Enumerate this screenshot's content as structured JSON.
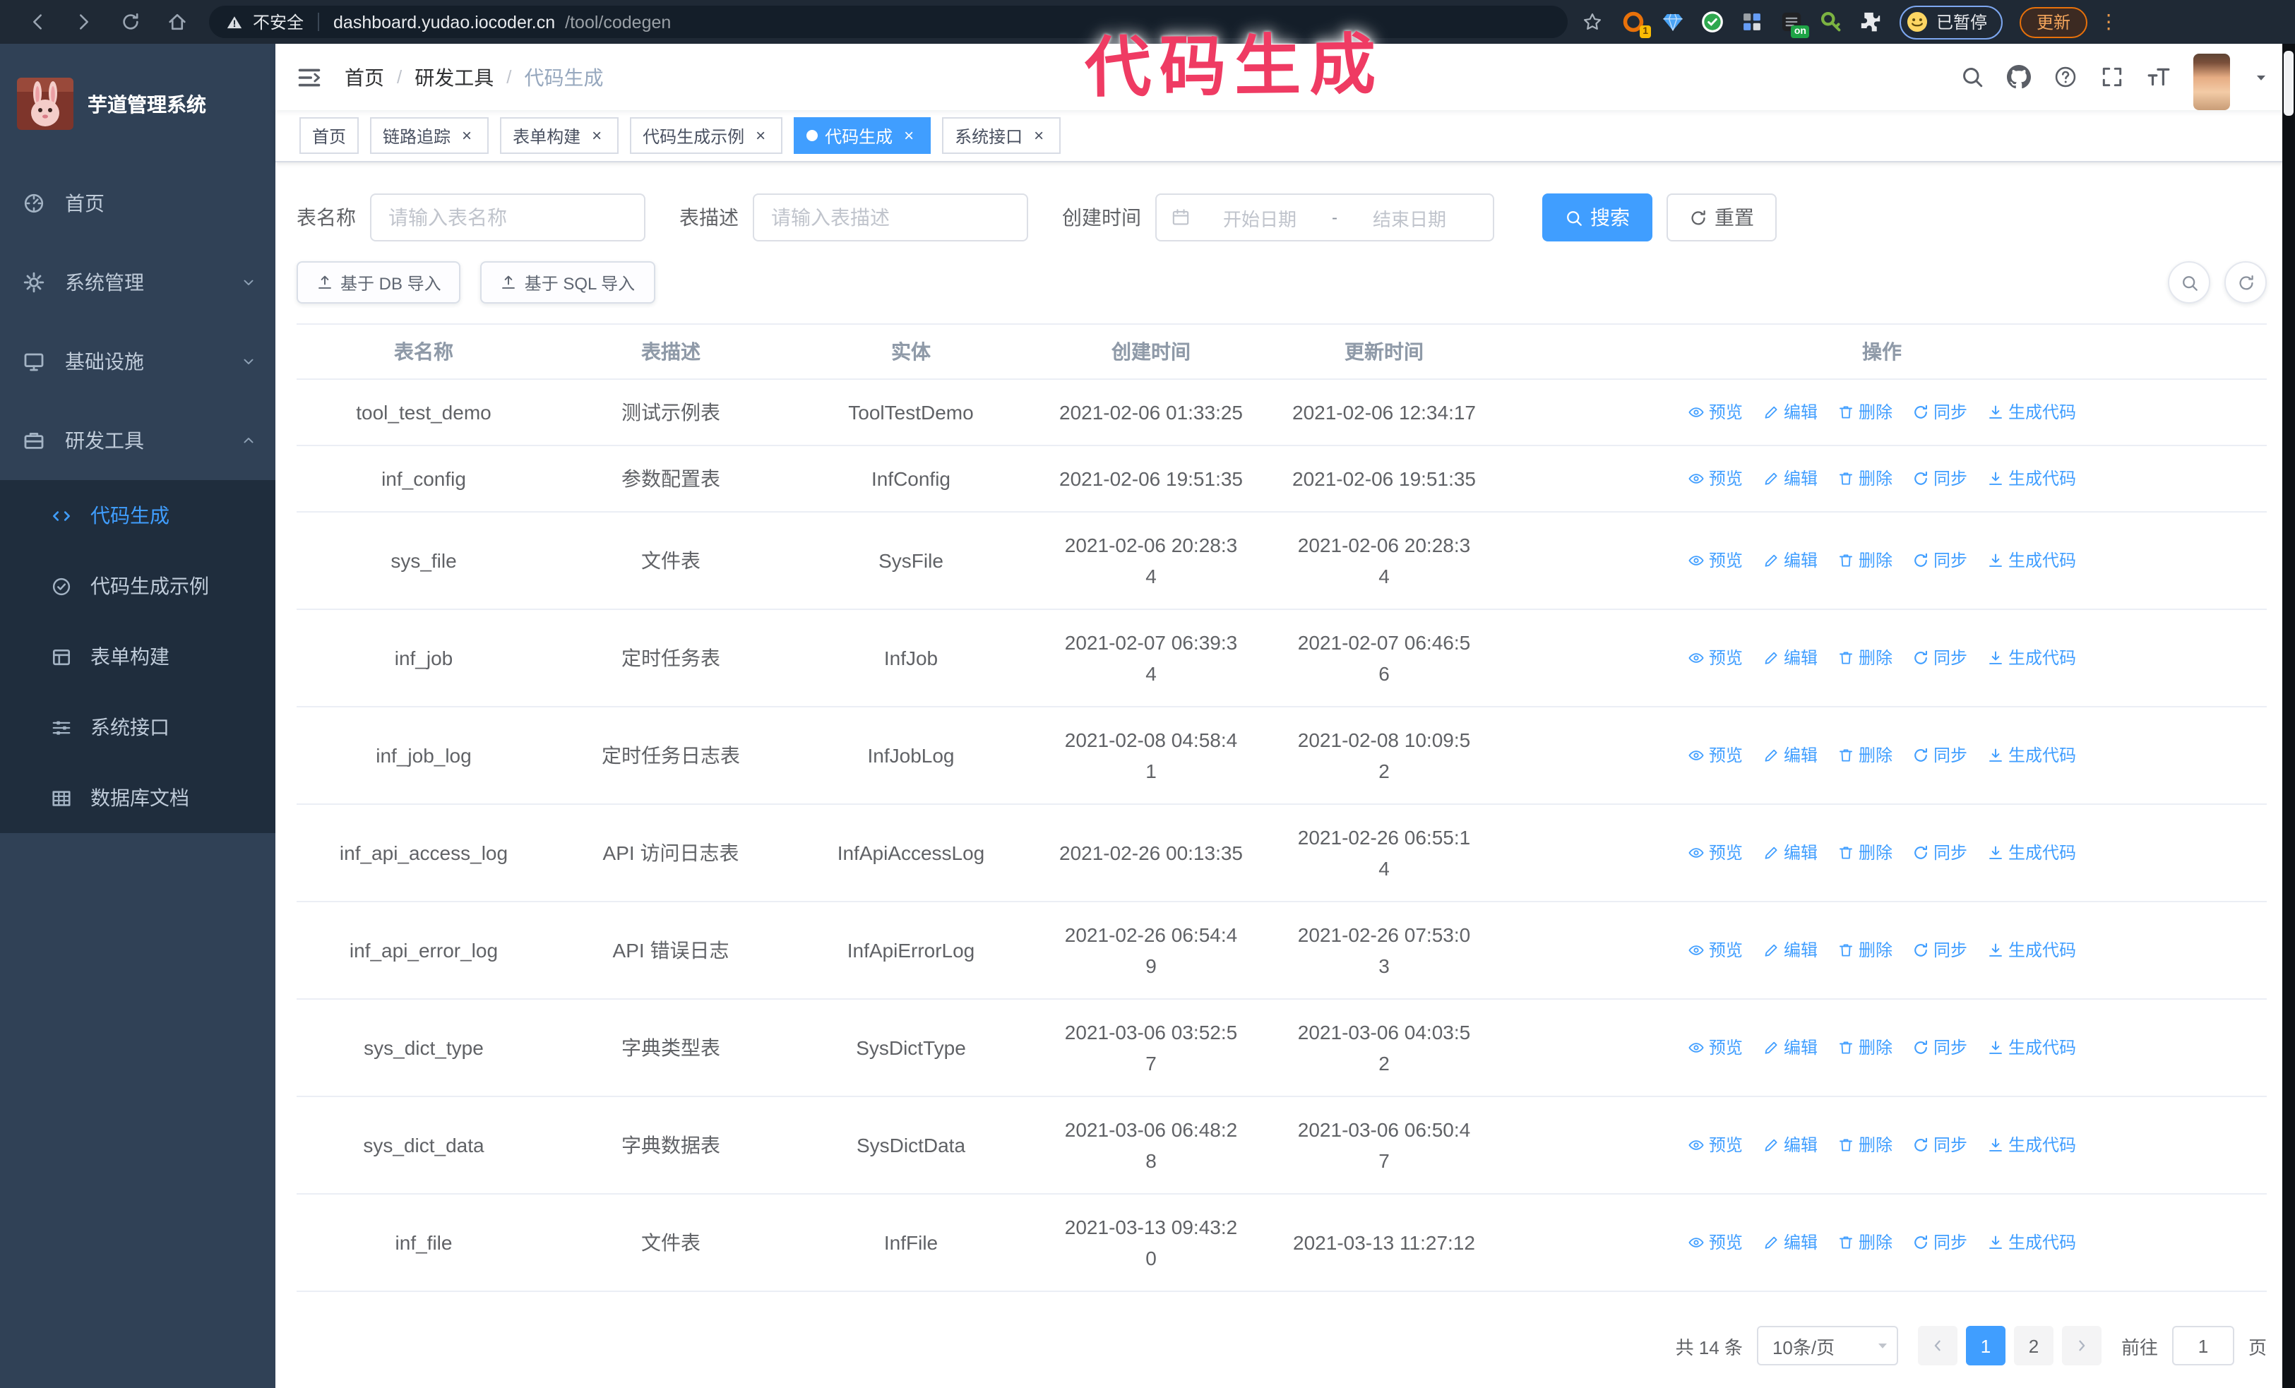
{
  "browser": {
    "security_label": "不安全",
    "url_host": "dashboard.yudao.iocoder.cn",
    "url_path": "/tool/codegen",
    "extension_badge": "1",
    "extension_on_badge": "on",
    "profile_chip_label": "已暂停",
    "update_button_label": "更新",
    "menu_dots": "⋮"
  },
  "annotation": {
    "text": "代码生成",
    "color": "#ef3b63"
  },
  "sidebar": {
    "title": "芋道管理系统",
    "items": [
      {
        "label": "首页",
        "icon": "dashboard-icon",
        "chevron": ""
      },
      {
        "label": "系统管理",
        "icon": "gear-icon",
        "chevron": "down"
      },
      {
        "label": "基础设施",
        "icon": "monitor-icon",
        "chevron": "down"
      },
      {
        "label": "研发工具",
        "icon": "toolbox-icon",
        "chevron": "up"
      }
    ],
    "subitems": [
      {
        "label": "代码生成",
        "icon": "code-icon",
        "active": true
      },
      {
        "label": "代码生成示例",
        "icon": "circle-check-icon",
        "active": false
      },
      {
        "label": "表单构建",
        "icon": "form-icon",
        "active": false
      },
      {
        "label": "系统接口",
        "icon": "sliders-icon",
        "active": false
      },
      {
        "label": "数据库文档",
        "icon": "table-grid-icon",
        "active": false
      }
    ]
  },
  "breadcrumb": [
    "首页",
    "研发工具",
    "代码生成"
  ],
  "tags": [
    {
      "label": "首页",
      "closable": false,
      "active": false
    },
    {
      "label": "链路追踪",
      "closable": true,
      "active": false
    },
    {
      "label": "表单构建",
      "closable": true,
      "active": false
    },
    {
      "label": "代码生成示例",
      "closable": true,
      "active": false
    },
    {
      "label": "代码生成",
      "closable": true,
      "active": true
    },
    {
      "label": "系统接口",
      "closable": true,
      "active": false
    }
  ],
  "search_form": {
    "fields": [
      {
        "label": "表名称",
        "placeholder": "请输入表名称",
        "name": "table-name-input"
      },
      {
        "label": "表描述",
        "placeholder": "请输入表描述",
        "name": "table-desc-input"
      }
    ],
    "date_label": "创建时间",
    "date_start_placeholder": "开始日期",
    "date_separator": "-",
    "date_end_placeholder": "结束日期",
    "search_label": "搜索",
    "reset_label": "重置"
  },
  "toolbar": {
    "import_db_label": "基于 DB 导入",
    "import_sql_label": "基于 SQL 导入"
  },
  "table": {
    "headers": [
      "表名称",
      "表描述",
      "实体",
      "创建时间",
      "更新时间",
      "操作"
    ],
    "actions": [
      {
        "label": "预览",
        "icon": "eye-icon"
      },
      {
        "label": "编辑",
        "icon": "edit-icon"
      },
      {
        "label": "删除",
        "icon": "delete-icon"
      },
      {
        "label": "同步",
        "icon": "sync-icon"
      },
      {
        "label": "生成代码",
        "icon": "download-icon"
      }
    ],
    "rows": [
      {
        "name": "tool_test_demo",
        "desc": "测试示例表",
        "entity": "ToolTestDemo",
        "create": [
          "2021-02-06 01:33:25"
        ],
        "update": [
          "2021-02-06 12:34:17"
        ]
      },
      {
        "name": "inf_config",
        "desc": "参数配置表",
        "entity": "InfConfig",
        "create": [
          "2021-02-06 19:51:35"
        ],
        "update": [
          "2021-02-06 19:51:35"
        ]
      },
      {
        "name": "sys_file",
        "desc": "文件表",
        "entity": "SysFile",
        "create": [
          "2021-02-06 20:28:3",
          "4"
        ],
        "update": [
          "2021-02-06 20:28:3",
          "4"
        ]
      },
      {
        "name": "inf_job",
        "desc": "定时任务表",
        "entity": "InfJob",
        "create": [
          "2021-02-07 06:39:3",
          "4"
        ],
        "update": [
          "2021-02-07 06:46:5",
          "6"
        ]
      },
      {
        "name": "inf_job_log",
        "desc": "定时任务日志表",
        "entity": "InfJobLog",
        "create": [
          "2021-02-08 04:58:4",
          "1"
        ],
        "update": [
          "2021-02-08 10:09:5",
          "2"
        ]
      },
      {
        "name": "inf_api_access_log",
        "desc": "API 访问日志表",
        "entity": "InfApiAccessLog",
        "create": [
          "2021-02-26 00:13:35"
        ],
        "update": [
          "2021-02-26 06:55:1",
          "4"
        ]
      },
      {
        "name": "inf_api_error_log",
        "desc": "API 错误日志",
        "entity": "InfApiErrorLog",
        "create": [
          "2021-02-26 06:54:4",
          "9"
        ],
        "update": [
          "2021-02-26 07:53:0",
          "3"
        ]
      },
      {
        "name": "sys_dict_type",
        "desc": "字典类型表",
        "entity": "SysDictType",
        "create": [
          "2021-03-06 03:52:5",
          "7"
        ],
        "update": [
          "2021-03-06 04:03:5",
          "2"
        ]
      },
      {
        "name": "sys_dict_data",
        "desc": "字典数据表",
        "entity": "SysDictData",
        "create": [
          "2021-03-06 06:48:2",
          "8"
        ],
        "update": [
          "2021-03-06 06:50:4",
          "7"
        ]
      },
      {
        "name": "inf_file",
        "desc": "文件表",
        "entity": "InfFile",
        "create": [
          "2021-03-13 09:43:2",
          "0"
        ],
        "update": [
          "2021-03-13 11:27:12"
        ]
      }
    ]
  },
  "pagination": {
    "total_text": "共 14 条",
    "page_size_text": "10条/页",
    "pages": [
      "1",
      "2"
    ],
    "active_page": "1",
    "goto_label": "前往",
    "goto_value": "1",
    "goto_suffix": "页"
  },
  "colors": {
    "accent": "#409eff",
    "sidebar_bg": "#304156",
    "submenu_bg": "#1f2d3d",
    "annotation": "#ef3b63",
    "chrome_bg": "#1f2935"
  }
}
